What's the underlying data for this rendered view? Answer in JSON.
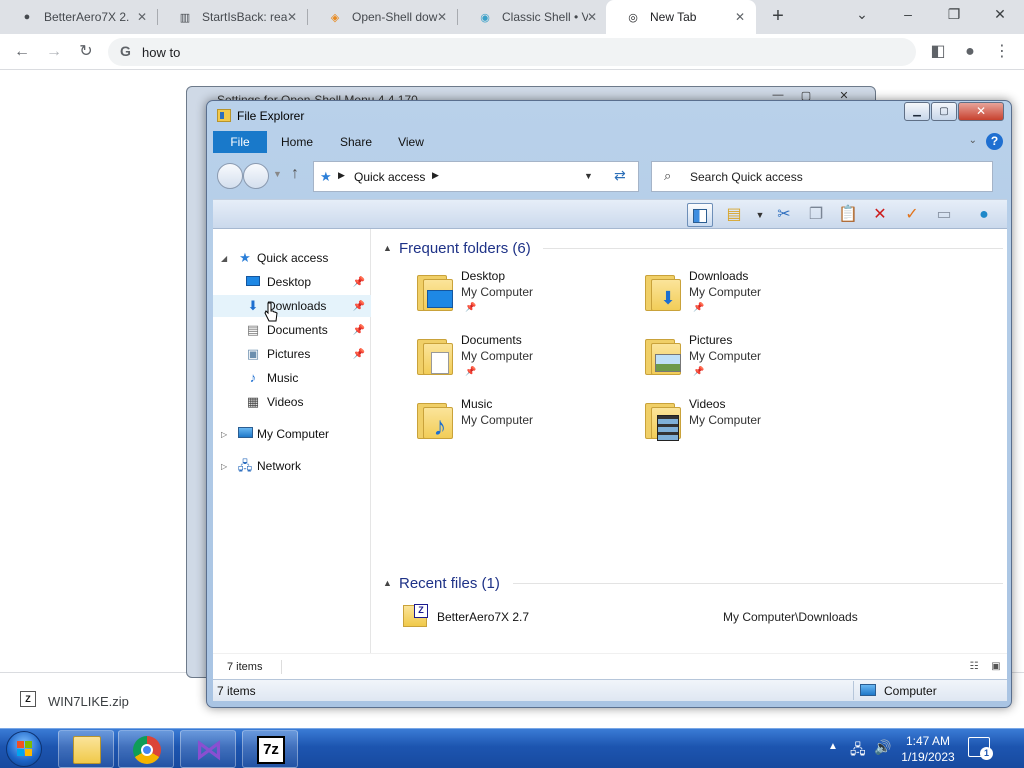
{
  "browser": {
    "tabs": [
      {
        "title": "BetterAero7X 2.",
        "icon": "github-icon",
        "active": false
      },
      {
        "title": "StartIsBack: real",
        "icon": "page-icon",
        "active": false
      },
      {
        "title": "Open-Shell dow",
        "icon": "diamond-icon",
        "active": false
      },
      {
        "title": "Classic Shell • V",
        "icon": "shell-icon",
        "active": false
      },
      {
        "title": "New Tab",
        "icon": "chrome-icon",
        "active": true
      }
    ],
    "omnibox_text": "how to",
    "download": {
      "filename": "WIN7LIKE.zip"
    }
  },
  "background_window": {
    "title": "Settings for Open-Shell Menu 4.4.170"
  },
  "explorer": {
    "title": "File Explorer",
    "ribbon_tabs": [
      "File",
      "Home",
      "Share",
      "View"
    ],
    "help_label": "?",
    "address": {
      "location": "Quick access"
    },
    "search_placeholder": "Search Quick access",
    "nav": {
      "quick_access": "Quick access",
      "items": [
        {
          "label": "Desktop",
          "pinned": true
        },
        {
          "label": "Downloads",
          "pinned": true
        },
        {
          "label": "Documents",
          "pinned": true
        },
        {
          "label": "Pictures",
          "pinned": true
        },
        {
          "label": "Music",
          "pinned": false
        },
        {
          "label": "Videos",
          "pinned": false
        }
      ],
      "my_computer": "My Computer",
      "network": "Network"
    },
    "frequent": {
      "header": "Frequent folders (6)",
      "folders": [
        {
          "name": "Desktop",
          "location": "My Computer",
          "pinned": true
        },
        {
          "name": "Downloads",
          "location": "My Computer",
          "pinned": true
        },
        {
          "name": "Documents",
          "location": "My Computer",
          "pinned": true
        },
        {
          "name": "Pictures",
          "location": "My Computer",
          "pinned": true
        },
        {
          "name": "Music",
          "location": "My Computer",
          "pinned": false
        },
        {
          "name": "Videos",
          "location": "My Computer",
          "pinned": false
        }
      ]
    },
    "recent": {
      "header": "Recent files (1)",
      "files": [
        {
          "name": "BetterAero7X 2.7",
          "path": "My Computer\\Downloads"
        }
      ]
    },
    "inner_status": "7 items",
    "status": {
      "count": "7 items",
      "location": "Computer"
    }
  },
  "taskbar": {
    "clock_time": "1:47 AM",
    "clock_date": "1/19/2023",
    "notification_count": "1",
    "apps": [
      "file-explorer",
      "chrome",
      "visual-studio",
      "7zip"
    ]
  },
  "colors": {
    "accent": "#1979ca",
    "taskbar": "#1d55b0",
    "section_header": "#1e3287"
  }
}
